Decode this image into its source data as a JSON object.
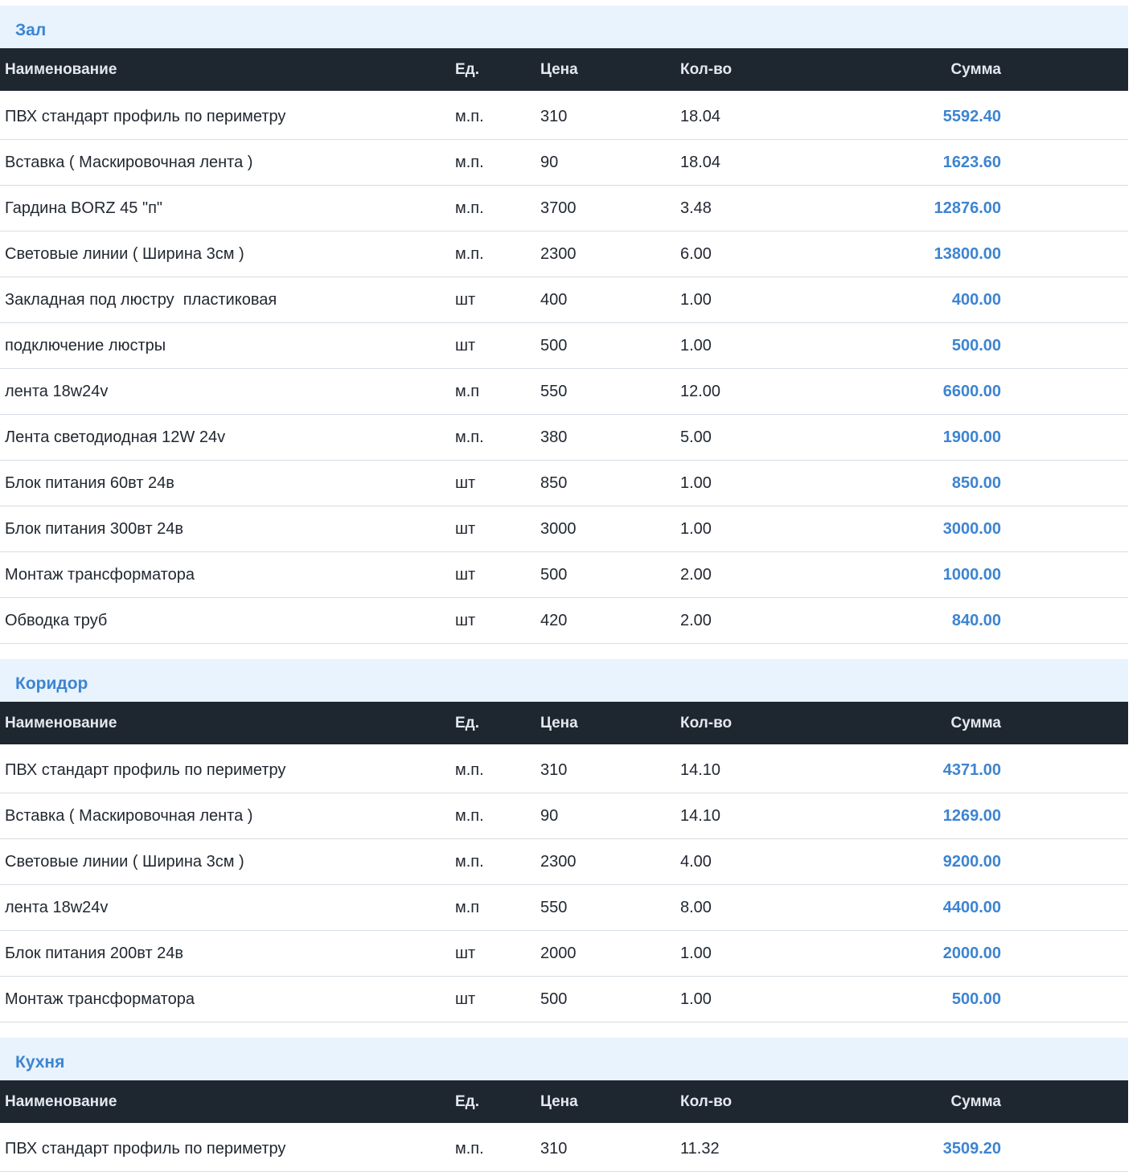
{
  "headers": {
    "name": "Наименование",
    "unit": "Ед.",
    "price": "Цена",
    "qty": "Кол-во",
    "sum": "Сумма"
  },
  "sections": [
    {
      "title": "Зал",
      "rows": [
        {
          "name": "ПВХ стандарт профиль по периметру",
          "unit": "м.п.",
          "price": "310",
          "qty": "18.04",
          "sum": "5592.40"
        },
        {
          "name": "Вставка ( Маскировочная лента )",
          "unit": "м.п.",
          "price": "90",
          "qty": "18.04",
          "sum": "1623.60"
        },
        {
          "name": "Гардина BORZ 45 \"п\"",
          "unit": "м.п.",
          "price": "3700",
          "qty": "3.48",
          "sum": "12876.00"
        },
        {
          "name": "Световые линии ( Ширина 3см )",
          "unit": "м.п.",
          "price": "2300",
          "qty": "6.00",
          "sum": "13800.00"
        },
        {
          "name": "Закладная под люстру  пластиковая",
          "unit": "шт",
          "price": "400",
          "qty": "1.00",
          "sum": "400.00"
        },
        {
          "name": "подключение люстры",
          "unit": "шт",
          "price": "500",
          "qty": "1.00",
          "sum": "500.00"
        },
        {
          "name": "лента 18w24v",
          "unit": "м.п",
          "price": "550",
          "qty": "12.00",
          "sum": "6600.00"
        },
        {
          "name": "Лента светодиодная 12W 24v",
          "unit": "м.п.",
          "price": "380",
          "qty": "5.00",
          "sum": "1900.00"
        },
        {
          "name": "Блок питания 60вт 24в",
          "unit": "шт",
          "price": "850",
          "qty": "1.00",
          "sum": "850.00"
        },
        {
          "name": "Блок питания 300вт 24в",
          "unit": "шт",
          "price": "3000",
          "qty": "1.00",
          "sum": "3000.00"
        },
        {
          "name": "Монтаж трансформатора",
          "unit": "шт",
          "price": "500",
          "qty": "2.00",
          "sum": "1000.00"
        },
        {
          "name": "Обводка труб",
          "unit": "шт",
          "price": "420",
          "qty": "2.00",
          "sum": "840.00"
        }
      ]
    },
    {
      "title": "Коридор",
      "rows": [
        {
          "name": "ПВХ стандарт профиль по периметру",
          "unit": "м.п.",
          "price": "310",
          "qty": "14.10",
          "sum": "4371.00"
        },
        {
          "name": "Вставка ( Маскировочная лента )",
          "unit": "м.п.",
          "price": "90",
          "qty": "14.10",
          "sum": "1269.00"
        },
        {
          "name": "Световые линии ( Ширина 3см )",
          "unit": "м.п.",
          "price": "2300",
          "qty": "4.00",
          "sum": "9200.00"
        },
        {
          "name": "лента 18w24v",
          "unit": "м.п",
          "price": "550",
          "qty": "8.00",
          "sum": "4400.00"
        },
        {
          "name": "Блок питания 200вт 24в",
          "unit": "шт",
          "price": "2000",
          "qty": "1.00",
          "sum": "2000.00"
        },
        {
          "name": "Монтаж трансформатора",
          "unit": "шт",
          "price": "500",
          "qty": "1.00",
          "sum": "500.00"
        }
      ]
    },
    {
      "title": "Кухня",
      "rows": [
        {
          "name": "ПВХ стандарт профиль по периметру",
          "unit": "м.п.",
          "price": "310",
          "qty": "11.32",
          "sum": "3509.20"
        }
      ]
    }
  ],
  "colors": {
    "accent": "#3d84d1",
    "header_bg": "#1e2630",
    "section_bg": "#e8f3fd"
  }
}
